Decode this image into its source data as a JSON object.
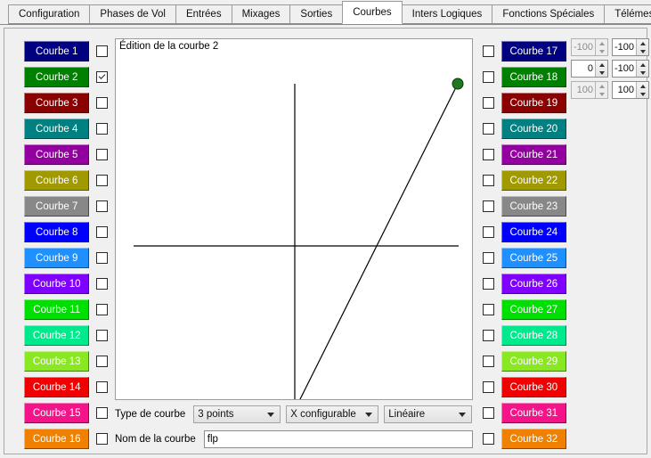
{
  "window": {
    "active_tab": "Courbes"
  },
  "tabs": [
    {
      "label": "Configuration",
      "active": false
    },
    {
      "label": "Phases de Vol",
      "active": false
    },
    {
      "label": "Entrées",
      "active": false
    },
    {
      "label": "Mixages",
      "active": false
    },
    {
      "label": "Sorties",
      "active": false
    },
    {
      "label": "Courbes",
      "active": true
    },
    {
      "label": "Inters Logiques",
      "active": false
    },
    {
      "label": "Fonctions Spéciales",
      "active": false
    },
    {
      "label": "Télémesure",
      "active": false
    }
  ],
  "curves_left": [
    {
      "label": "Courbe 1",
      "color": "#000080",
      "checked": false
    },
    {
      "label": "Courbe 2",
      "color": "#008000",
      "checked": true
    },
    {
      "label": "Courbe 3",
      "color": "#8b0000",
      "checked": false
    },
    {
      "label": "Courbe 4",
      "color": "#008080",
      "checked": false
    },
    {
      "label": "Courbe 5",
      "color": "#9400a0",
      "checked": false
    },
    {
      "label": "Courbe 6",
      "color": "#a09a00",
      "checked": false
    },
    {
      "label": "Courbe 7",
      "color": "#888888",
      "checked": false
    },
    {
      "label": "Courbe 8",
      "color": "#0000ff",
      "checked": false
    },
    {
      "label": "Courbe 9",
      "color": "#1e90ff",
      "checked": false
    },
    {
      "label": "Courbe 10",
      "color": "#8000ff",
      "checked": false
    },
    {
      "label": "Courbe 11",
      "color": "#00e000",
      "checked": false
    },
    {
      "label": "Courbe 12",
      "color": "#00e98d",
      "checked": false
    },
    {
      "label": "Courbe 13",
      "color": "#8ae823",
      "checked": false
    },
    {
      "label": "Courbe 14",
      "color": "#f00000",
      "checked": false
    },
    {
      "label": "Courbe 15",
      "color": "#f41388",
      "checked": false
    },
    {
      "label": "Courbe 16",
      "color": "#f08000",
      "checked": false
    }
  ],
  "curves_right": [
    {
      "label": "Courbe 17",
      "color": "#000080",
      "checked": false
    },
    {
      "label": "Courbe 18",
      "color": "#008000",
      "checked": false
    },
    {
      "label": "Courbe 19",
      "color": "#8b0000",
      "checked": false
    },
    {
      "label": "Courbe 20",
      "color": "#008080",
      "checked": false
    },
    {
      "label": "Courbe 21",
      "color": "#9400a0",
      "checked": false
    },
    {
      "label": "Courbe 22",
      "color": "#a09a00",
      "checked": false
    },
    {
      "label": "Courbe 23",
      "color": "#888888",
      "checked": false
    },
    {
      "label": "Courbe 24",
      "color": "#0000ff",
      "checked": false
    },
    {
      "label": "Courbe 25",
      "color": "#1e90ff",
      "checked": false
    },
    {
      "label": "Courbe 26",
      "color": "#8000ff",
      "checked": false
    },
    {
      "label": "Courbe 27",
      "color": "#00e000",
      "checked": false
    },
    {
      "label": "Courbe 28",
      "color": "#00e98d",
      "checked": false
    },
    {
      "label": "Courbe 29",
      "color": "#8ae823",
      "checked": false
    },
    {
      "label": "Courbe 30",
      "color": "#f00000",
      "checked": false
    },
    {
      "label": "Courbe 31",
      "color": "#f41388",
      "checked": false
    },
    {
      "label": "Courbe 32",
      "color": "#f08000",
      "checked": false
    }
  ],
  "graph": {
    "title": "Édition de la courbe 2",
    "point_color": "#1f7a1f",
    "line_color": "#000000",
    "axis_color": "#000000"
  },
  "chart_data": {
    "type": "line",
    "title": "Édition de la courbe 2",
    "xlabel": "",
    "ylabel": "",
    "xlim": [
      -100,
      100
    ],
    "ylim": [
      -100,
      100
    ],
    "grid": false,
    "legend": "none",
    "series": [
      {
        "name": "Courbe 2",
        "x": [
          -100,
          0,
          100
        ],
        "y": [
          -100,
          -100,
          100
        ]
      }
    ]
  },
  "controls": {
    "type_label": "Type de courbe",
    "name_label": "Nom de la courbe",
    "points_dropdown": "3 points",
    "x_dropdown": "X configurable",
    "interp_dropdown": "Linéaire",
    "name_value": "flp",
    "name_placeholder": ""
  },
  "spinners": [
    {
      "value": "-100",
      "disabled": true
    },
    {
      "value": "-100",
      "disabled": false
    },
    {
      "value": "0",
      "disabled": false
    },
    {
      "value": "-100",
      "disabled": false
    },
    {
      "value": "100",
      "disabled": true
    },
    {
      "value": "100",
      "disabled": false
    }
  ]
}
